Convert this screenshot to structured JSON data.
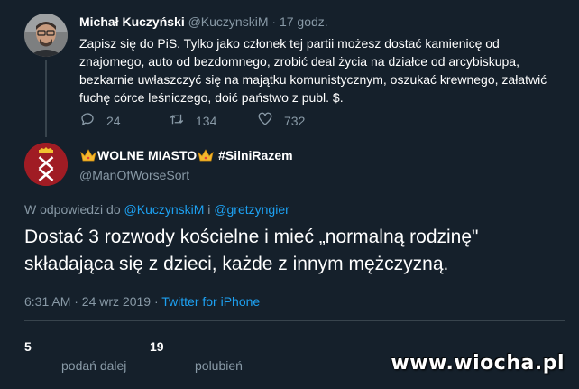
{
  "parent_tweet": {
    "name": "Michał Kuczyński",
    "handle": "@KuczynskiM",
    "time_sep": " · ",
    "time": "17 godz.",
    "text": "Zapisz się do PiS. Tylko jako członek tej partii możesz dostać kamienicę od znajomego, auto od bezdomnego, zrobić deal życia na działce od arcybiskupa, bezkarnie uwłaszczyć się na majątku komunistycznym, oszukać krewnego, załatwić fuchę córce leśniczego, doić państwo z publ. $.",
    "replies": "24",
    "retweets": "134",
    "likes": "732"
  },
  "main_tweet": {
    "name_part1": "WOLNE MIASTO",
    "name_part2": " #SilniRazem",
    "handle": "@ManOfWorseSort",
    "reply_prefix": "W odpowiedzi do ",
    "reply_user1": "@KuczynskiM",
    "reply_and": " i ",
    "reply_user2": "@gretzyngier",
    "text": "Dostać 3 rozwody kościelne i mieć „normalną rodzinę\" składająca się z dzieci, każde z innym mężczyzną.",
    "time": "6:31 AM · 24 wrz 2019 · ",
    "source": "Twitter for iPhone",
    "retweet_count": "5",
    "retweet_label": "podań dalej",
    "like_count": "19",
    "like_label": "polubień"
  },
  "watermark": "www.wiocha.pl",
  "colors": {
    "background": "#15202b",
    "secondary_text": "#8899a6",
    "link": "#1da1f2",
    "divider": "#38444d"
  },
  "icons": [
    "reply-icon",
    "retweet-icon",
    "like-icon",
    "crown-icon",
    "gdansk-coat-of-arms-icon"
  ]
}
